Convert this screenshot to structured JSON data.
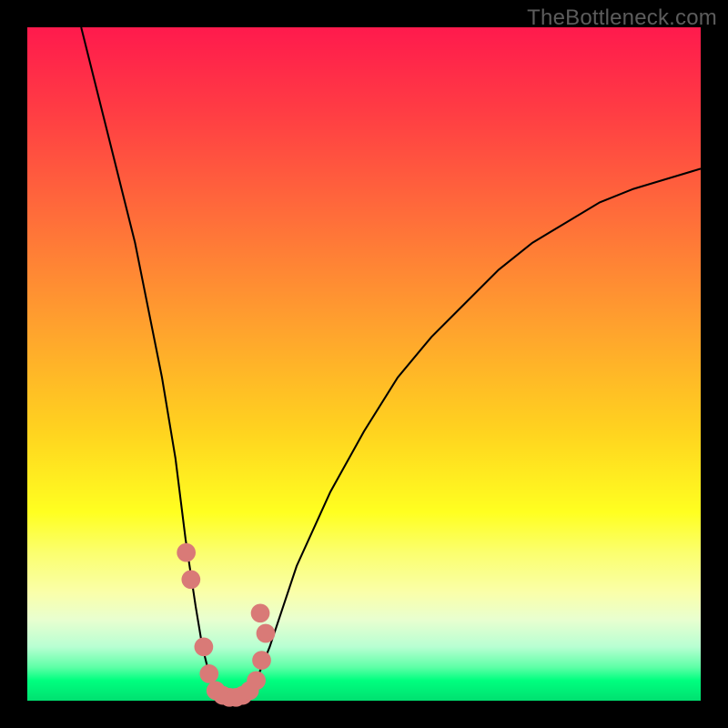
{
  "watermark": {
    "text": "TheBottleneck.com"
  },
  "colors": {
    "frame": "#000000",
    "gradient_top": "#ff1a4d",
    "gradient_bottom": "#00e070",
    "curve": "#000000",
    "marker": "#d97a77"
  },
  "chart_data": {
    "type": "line",
    "title": "",
    "xlabel": "",
    "ylabel": "",
    "xlim": [
      0,
      100
    ],
    "ylim": [
      0,
      100
    ],
    "note": "Bottleneck-percentage style curve. Values estimated from pixels; x is horizontal position (0–100), y is vertical height above bottom (0–100).",
    "series": [
      {
        "name": "bottleneck-curve",
        "x": [
          8,
          10,
          12,
          14,
          16,
          18,
          20,
          22,
          23.5,
          25,
          26,
          27,
          28,
          29,
          30,
          31,
          32,
          33,
          34,
          36,
          38,
          40,
          45,
          50,
          55,
          60,
          65,
          70,
          75,
          80,
          85,
          90,
          95,
          100
        ],
        "y": [
          100,
          92,
          84,
          76,
          68,
          58,
          48,
          36,
          24,
          14,
          8,
          4,
          1,
          0,
          0,
          0,
          0,
          1,
          3,
          8,
          14,
          20,
          31,
          40,
          48,
          54,
          59,
          64,
          68,
          71,
          74,
          76,
          77.5,
          79
        ]
      }
    ],
    "markers": {
      "name": "highlight-points",
      "x": [
        23.6,
        24.3,
        26.2,
        27.0,
        28.0,
        29.0,
        30.0,
        31.0,
        32.0,
        33.0,
        34.0,
        34.8,
        35.4,
        34.6
      ],
      "y": [
        22,
        18,
        8,
        4,
        1.5,
        0.8,
        0.5,
        0.5,
        0.8,
        1.5,
        3,
        6,
        10,
        13
      ],
      "radius": 1.4
    }
  }
}
